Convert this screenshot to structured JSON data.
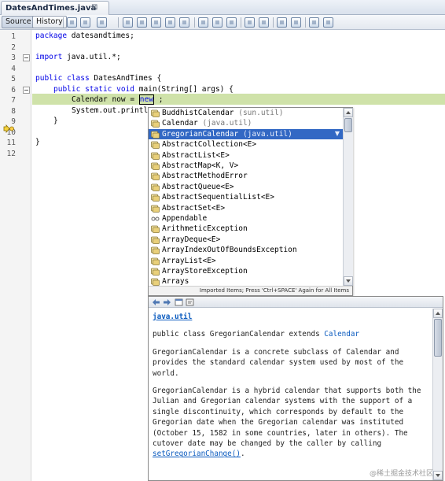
{
  "editor": {
    "file_tab": "DatesAndTimes.java",
    "tab_close": "⊠",
    "source_tab": "Source",
    "history_tab": "History"
  },
  "gutter": {
    "line_numbers": [
      "1",
      "2",
      "3",
      "4",
      "5",
      "6",
      "7",
      "8",
      "9",
      "10",
      "11",
      "12"
    ]
  },
  "code": {
    "line1": {
      "kw": "package",
      "rest": " datesandtimes;"
    },
    "line3": {
      "kw": "import",
      "rest": " java.util.*;"
    },
    "line5": {
      "kw1": "public",
      "kw2": "class",
      "rest": " DatesAndTimes {"
    },
    "line6": {
      "kw1": "public",
      "kw2": "static",
      "kw3": "void",
      "rest": " main(String[] args) {"
    },
    "line7": {
      "text": "Calendar now = ",
      "kw": "new",
      "rest": " ;"
    },
    "line8": {
      "text": "System.out.println"
    },
    "line9": {
      "text": "}"
    },
    "line11": {
      "text": "}"
    }
  },
  "completion": {
    "items": [
      {
        "name": "BuddhistCalendar",
        "pkg": " (sun.util)",
        "icon": "class-icon"
      },
      {
        "name": "Calendar",
        "pkg": " (java.util)",
        "icon": "class-icon"
      },
      {
        "name": "GregorianCalendar",
        "pkg": " (java.util)",
        "icon": "class-icon"
      },
      {
        "name": "AbstractCollection<E>",
        "pkg": "",
        "icon": "class-icon"
      },
      {
        "name": "AbstractList<E>",
        "pkg": "",
        "icon": "class-icon"
      },
      {
        "name": "AbstractMap<K, V>",
        "pkg": "",
        "icon": "class-icon"
      },
      {
        "name": "AbstractMethodError",
        "pkg": "",
        "icon": "class-icon"
      },
      {
        "name": "AbstractQueue<E>",
        "pkg": "",
        "icon": "class-icon"
      },
      {
        "name": "AbstractSequentialList<E>",
        "pkg": "",
        "icon": "class-icon"
      },
      {
        "name": "AbstractSet<E>",
        "pkg": "",
        "icon": "class-icon"
      },
      {
        "name": "Appendable",
        "pkg": "",
        "icon": "interface-icon"
      },
      {
        "name": "ArithmeticException",
        "pkg": "",
        "icon": "class-icon"
      },
      {
        "name": "ArrayDeque<E>",
        "pkg": "",
        "icon": "class-icon"
      },
      {
        "name": "ArrayIndexOutOfBoundsException",
        "pkg": "",
        "icon": "class-icon"
      },
      {
        "name": "ArrayList<E>",
        "pkg": "",
        "icon": "class-icon"
      },
      {
        "name": "ArrayStoreException",
        "pkg": "",
        "icon": "class-icon"
      },
      {
        "name": "Arrays",
        "pkg": "",
        "icon": "class-icon"
      }
    ],
    "selected_index": 2,
    "footer": "Imported Items; Press 'Ctrl+SPACE' Again for All Items"
  },
  "doc": {
    "package_link": "java.util",
    "declaration": "public class GregorianCalendar extends ",
    "declaration_link": "Calendar",
    "para1": "GregorianCalendar is a concrete subclass of Calendar and provides the standard calendar system used by most of the world.",
    "para2": "GregorianCalendar is a hybrid calendar that supports both the Julian and Gregorian calendar systems with the support of a single discontinuity, which corresponds by default to the Gregorian date when the Gregorian calendar was instituted (October 15, 1582 in some countries, later in others). The cutover date may be changed by the caller by calling ",
    "para2_link": "setGregorianChange()",
    "para2_end": "."
  },
  "watermark": "@稀土掘金技术社区",
  "colors": {
    "keyword": "#0000e6",
    "current_line": "#cfe2a9",
    "selection": "#3268c4",
    "link": "#0b5bbf"
  }
}
